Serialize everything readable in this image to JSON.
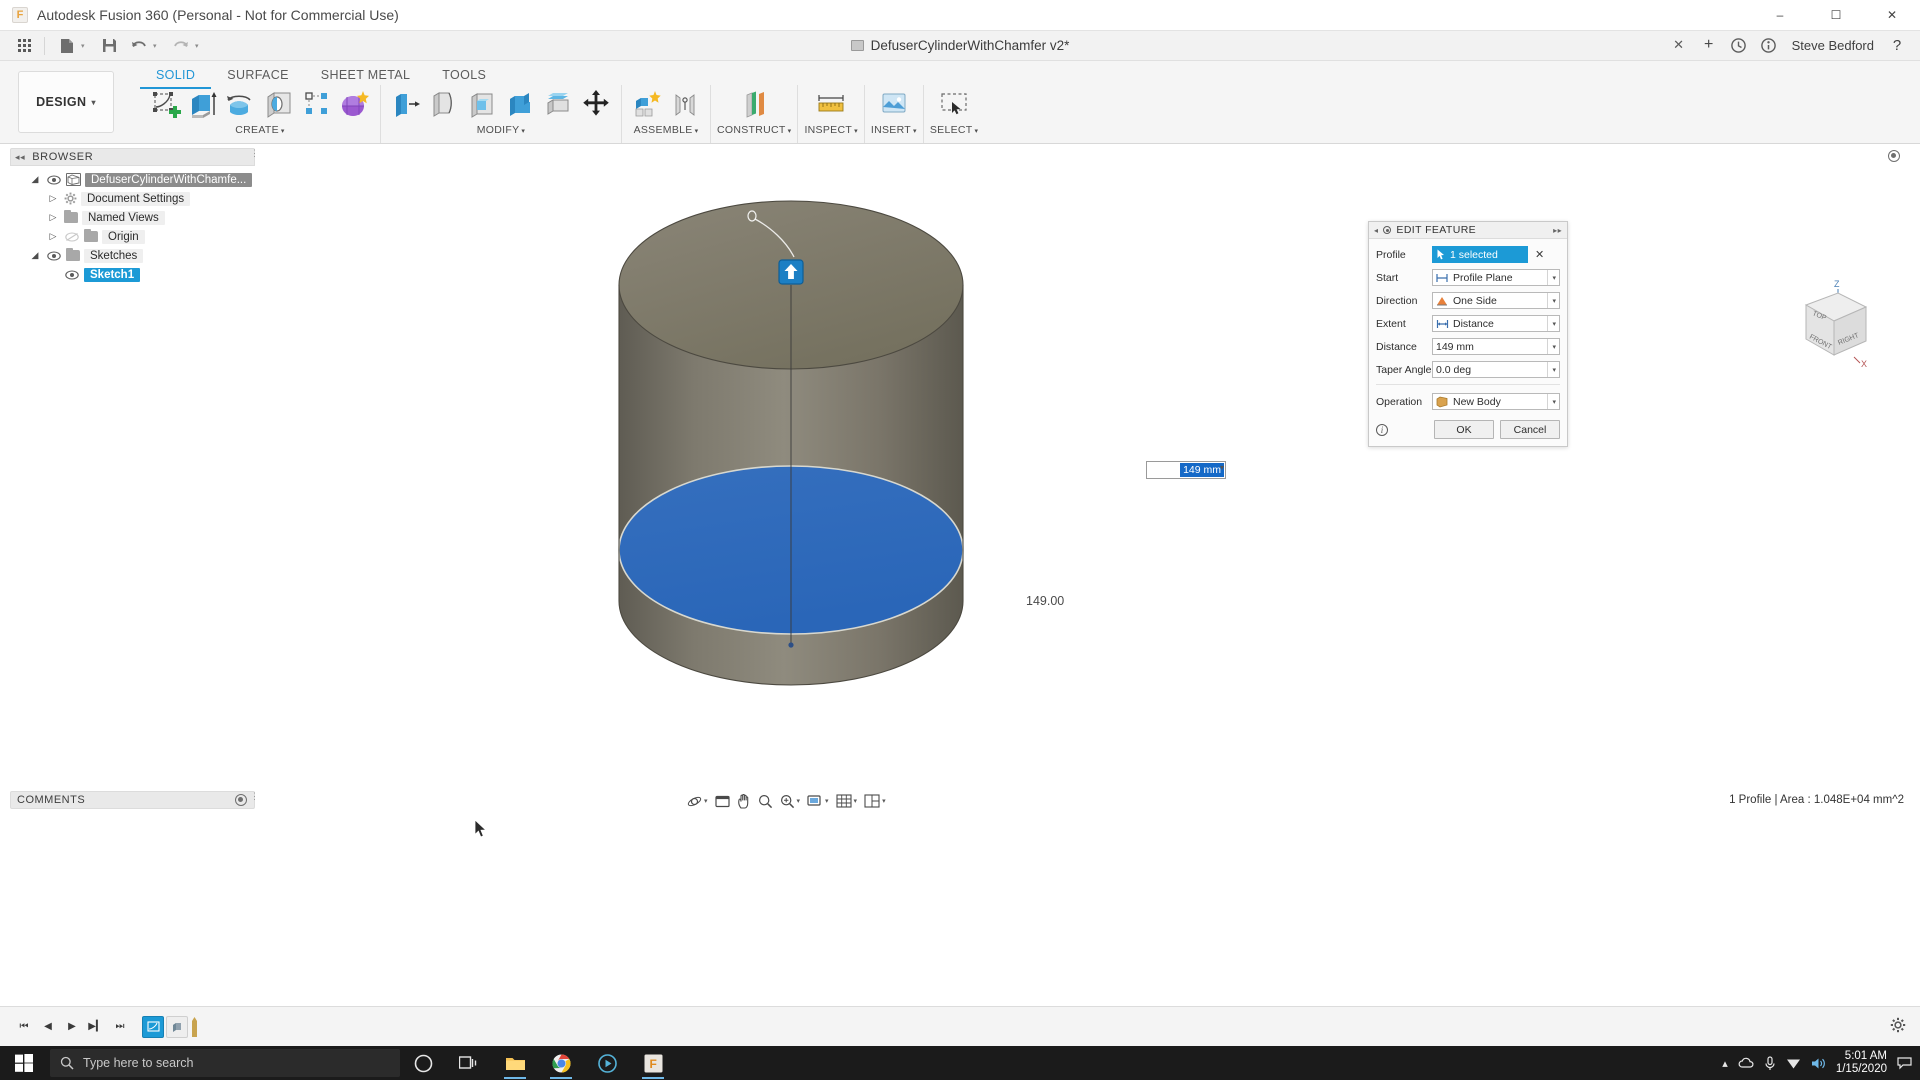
{
  "titlebar": {
    "app_title": "Autodesk Fusion 360 (Personal - Not for Commercial Use)",
    "app_icon": "fusion360-icon",
    "minimize": "–",
    "maximize": "☐",
    "close": "✕"
  },
  "quick_access": {
    "grid_label": "grid-menu-icon",
    "new_label": "new-document-icon",
    "save_label": "save-icon",
    "undo_label": "undo-icon",
    "redo_label": "redo-icon",
    "caret": "▾"
  },
  "document_tab": {
    "name": "DefuserCylinderWithChamfer v2*",
    "close": "✕",
    "add": "+"
  },
  "account": {
    "user_name": "Steve Bedford",
    "help_label": "?",
    "jobs_icon": "jobs-status-icon",
    "notifications_icon": "notifications-icon"
  },
  "workspace": {
    "label": "DESIGN",
    "caret": "▾"
  },
  "ribbon": {
    "tabs": [
      {
        "label": "SOLID",
        "active": true
      },
      {
        "label": "SURFACE",
        "active": false
      },
      {
        "label": "SHEET METAL",
        "active": false
      },
      {
        "label": "TOOLS",
        "active": false
      }
    ],
    "groups": [
      {
        "label": "CREATE",
        "caret": "▾",
        "icons": [
          "create-sketch-icon",
          "extrude-icon",
          "revolve-icon",
          "hole-icon",
          "pattern-icon",
          "form-icon"
        ]
      },
      {
        "label": "MODIFY",
        "caret": "▾",
        "icons": [
          "press-pull-icon",
          "fillet-icon",
          "shell-icon",
          "combine-icon",
          "offset-face-icon",
          "move-copy-icon"
        ]
      },
      {
        "label": "ASSEMBLE",
        "caret": "▾",
        "icons": [
          "new-component-icon",
          "joint-icon"
        ]
      },
      {
        "label": "CONSTRUCT",
        "caret": "▾",
        "icons": [
          "offset-plane-icon"
        ]
      },
      {
        "label": "INSPECT",
        "caret": "▾",
        "icons": [
          "measure-icon"
        ]
      },
      {
        "label": "INSERT",
        "caret": "▾",
        "icons": [
          "insert-mcmaster-icon"
        ]
      },
      {
        "label": "SELECT",
        "caret": "▾",
        "icons": [
          "select-icon"
        ]
      }
    ]
  },
  "browser": {
    "title": "BROWSER",
    "collapse_icon": "◂◂",
    "settings_icon": "browser-options-icon",
    "items": [
      {
        "label": "DefuserCylinderWithChamfe...",
        "indent": 0,
        "expander": "◢",
        "has_eye": true,
        "icon": "component-icon",
        "state": "selected"
      },
      {
        "label": "Document Settings",
        "indent": 1,
        "expander": "▷",
        "has_eye": false,
        "icon": "gear-icon",
        "state": "normal"
      },
      {
        "label": "Named Views",
        "indent": 1,
        "expander": "▷",
        "has_eye": false,
        "icon": "folder-icon",
        "state": "normal"
      },
      {
        "label": "Origin",
        "indent": 1,
        "expander": "▷",
        "has_eye": true,
        "eye_off": true,
        "icon": "folder-icon",
        "state": "dim"
      },
      {
        "label": "Sketches",
        "indent": 1,
        "expander": "◢",
        "has_eye": true,
        "icon": "folder-icon",
        "state": "normal"
      },
      {
        "label": "Sketch1",
        "indent": 2,
        "expander": "",
        "has_eye": true,
        "icon": "sketch-icon",
        "state": "selected-blue"
      }
    ]
  },
  "comments": {
    "title": "COMMENTS",
    "settings_icon": "comments-options-icon"
  },
  "canvas": {
    "dimension_edit_value": "149 mm",
    "dimension_caret": "▾",
    "dimension_label": "149.00",
    "direction_handle_icon": "extrude-arrow-handle",
    "cursor_icon": "mouse-pointer",
    "colors": {
      "body_top": "#817d71",
      "body_side_light": "#8e897c",
      "body_side_dark": "#6e6a60",
      "profile_blue": "#2f6fc0",
      "accent_blue": "#1c9ad6"
    }
  },
  "viewcube": {
    "faces": [
      "TOP",
      "FRONT",
      "RIGHT"
    ],
    "axes": [
      "Z",
      "X"
    ]
  },
  "dialog": {
    "title": "EDIT FEATURE",
    "left_caret": "◂",
    "right_caret": "▸▸",
    "rows": [
      {
        "label": "Profile",
        "type": "selection",
        "value": "1 selected",
        "icon": "cursor-select-icon",
        "clear": "✕"
      },
      {
        "label": "Start",
        "type": "combo",
        "value": "Profile Plane",
        "icon": "profile-plane-icon",
        "caret": "▾"
      },
      {
        "label": "Direction",
        "type": "combo",
        "value": "One Side",
        "icon": "one-side-icon",
        "caret": "▾"
      },
      {
        "label": "Extent",
        "type": "combo",
        "value": "Distance",
        "icon": "distance-icon",
        "caret": "▾"
      },
      {
        "label": "Distance",
        "type": "input",
        "value": "149 mm",
        "caret": "▾"
      },
      {
        "label": "Taper Angle",
        "type": "input",
        "value": "0.0 deg",
        "caret": "▾"
      },
      {
        "label": "Operation",
        "type": "combo",
        "value": "New Body",
        "icon": "new-body-icon",
        "caret": "▾"
      }
    ],
    "info_icon": "i",
    "ok_label": "OK",
    "cancel_label": "Cancel"
  },
  "navbar": {
    "items": [
      {
        "icon": "orbit-icon",
        "caret": "▾"
      },
      {
        "icon": "pan-window-icon",
        "caret": ""
      },
      {
        "icon": "pan-hand-icon",
        "caret": ""
      },
      {
        "icon": "zoom-icon",
        "caret": ""
      },
      {
        "icon": "zoom-fit-icon",
        "caret": "▾"
      },
      {
        "icon": "display-settings-icon",
        "caret": "▾"
      },
      {
        "icon": "grid-snaps-icon",
        "caret": "▾"
      },
      {
        "icon": "viewports-icon",
        "caret": "▾"
      }
    ]
  },
  "status": {
    "text": "1 Profile | Area : 1.048E+04 mm^2"
  },
  "timeline": {
    "buttons": [
      "⏮",
      "◀",
      "▶",
      "▶▎",
      "⏭"
    ],
    "nodes": [
      "sketch1-node",
      "extrude1-node",
      "marker-node"
    ],
    "settings_icon": "timeline-settings-icon"
  },
  "taskbar": {
    "start_icon": "windows-start-icon",
    "search_placeholder": "Type here to search",
    "search_icon": "search-icon",
    "apps": [
      {
        "name": "cortana-icon"
      },
      {
        "name": "task-view-icon"
      },
      {
        "name": "file-explorer-icon"
      },
      {
        "name": "chrome-icon"
      },
      {
        "name": "media-player-icon"
      },
      {
        "name": "fusion360-taskbar-icon"
      }
    ],
    "tray": {
      "up_arrow": "▴",
      "onedrive_icon": "onedrive-icon",
      "mic_icon": "microphone-icon",
      "network_icon": "network-icon",
      "volume_icon": "volume-icon",
      "time": "5:01 AM",
      "date": "1/15/2020",
      "action_center": "notification-icon"
    }
  }
}
